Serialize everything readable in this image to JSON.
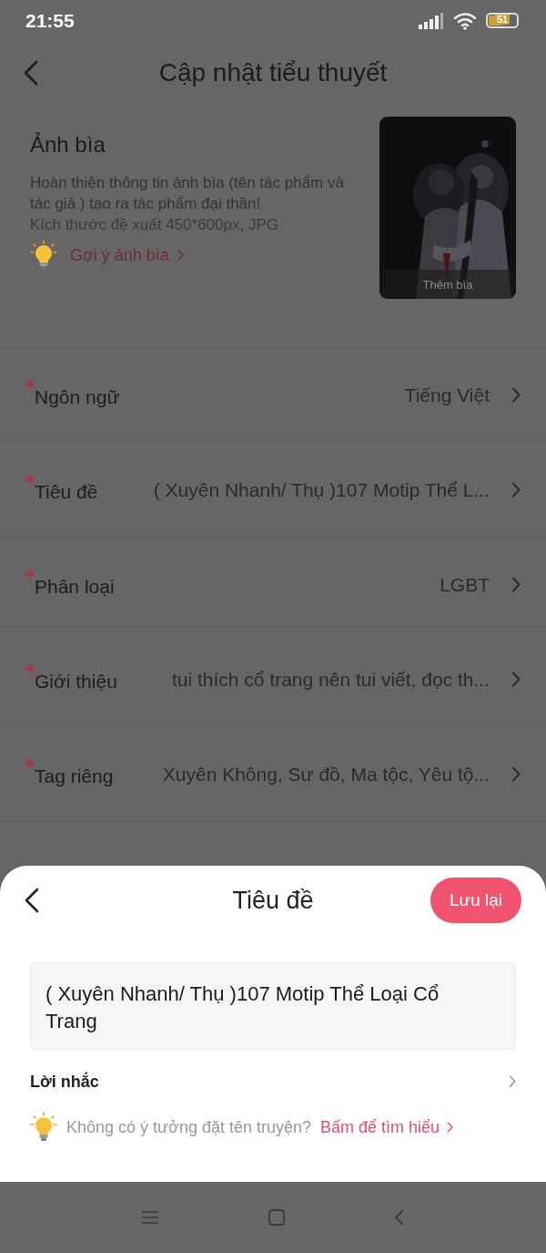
{
  "status_bar": {
    "time": "21:55",
    "battery": "51"
  },
  "header": {
    "title": "Cập nhật tiểu thuyết"
  },
  "cover": {
    "title": "Ảnh bìa",
    "description": "Hoàn thiện thông tin ảnh bìa (tên tác phẩm và tác giả ) tạo ra tác phẩm đại thần!",
    "size_hint": "Kích thước đề xuất 450*600px, JPG",
    "tip_link": "Gợi ý ảnh bìa",
    "image": {
      "kind": "picture",
      "caption": "Thêm bìa"
    }
  },
  "fields": [
    {
      "label": "Ngôn ngữ",
      "value": "Tiếng Việt",
      "required": true
    },
    {
      "label": "Tiêu đề",
      "value": "( Xuyên Nhanh/ Thụ )107 Motip Thể L...",
      "required": true
    },
    {
      "label": "Phân loại",
      "value": "LGBT",
      "required": true
    },
    {
      "label": "Giới thiệu",
      "value": "tui thích cổ trang nên tui viết, đọc th...",
      "required": true
    },
    {
      "label": "Tag riêng",
      "value": "Xuyên Không, Sư đồ, Ma tộc, Yêu tộ...",
      "required": true
    }
  ],
  "sheet": {
    "title": "Tiêu đề",
    "save_button": "Lưu lại",
    "input_value": "( Xuyên Nhanh/ Thụ )107 Motip Thể Loại Cổ Trang",
    "reminder_label": "Lời nhắc",
    "hint_text": "Không có ý tưởng đặt tên truyện?",
    "hint_link": "Bấm để tìm hiểu"
  }
}
